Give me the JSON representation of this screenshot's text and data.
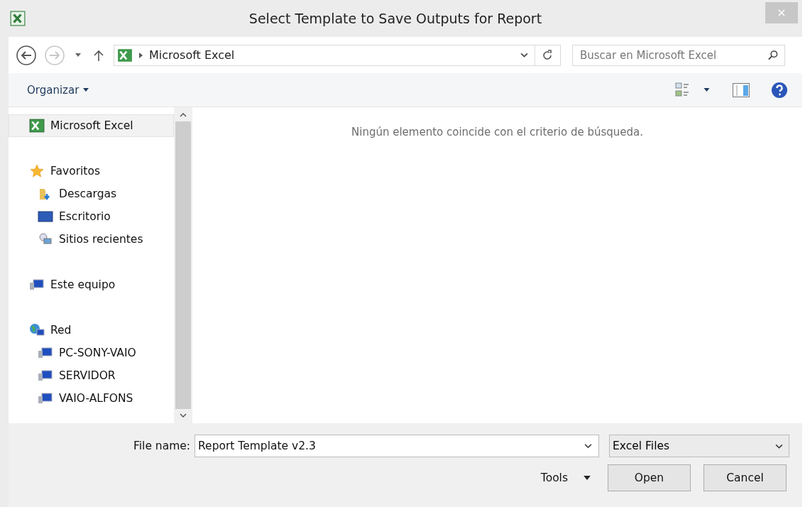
{
  "window": {
    "title": "Select Template to Save Outputs for Report"
  },
  "navigation": {
    "back": {
      "disabled": false
    },
    "forward": {
      "disabled": true
    },
    "path": [
      "Microsoft Excel"
    ],
    "search": {
      "placeholder": "Buscar en Microsoft Excel"
    }
  },
  "toolbar": {
    "organize": "Organizar"
  },
  "sidebar": {
    "items": [
      {
        "label": "Microsoft Excel",
        "kind": "excel",
        "selected": true
      },
      {
        "label": "Favoritos",
        "kind": "star",
        "selected": false,
        "children": [
          {
            "label": "Descargas",
            "kind": "downloads",
            "selected": false
          },
          {
            "label": "Escritorio",
            "kind": "desktop",
            "selected": false
          },
          {
            "label": "Sitios recientes",
            "kind": "recent",
            "selected": false
          }
        ]
      },
      {
        "label": "Este equipo",
        "kind": "computer",
        "selected": false
      },
      {
        "label": "Red",
        "kind": "network",
        "selected": false,
        "children": [
          {
            "label": "PC-SONY-VAIO",
            "kind": "computer",
            "selected": false
          },
          {
            "label": "SERVIDOR",
            "kind": "computer",
            "selected": false
          },
          {
            "label": "VAIO-ALFONS",
            "kind": "computer",
            "selected": false
          }
        ]
      }
    ]
  },
  "content": {
    "message": "Ningún elemento coincide con el criterio de búsqueda."
  },
  "footer": {
    "file_name_label": "File name:",
    "file_name": "Report Template v2.3",
    "file_type": "Excel Files",
    "tools": "Tools",
    "buttons": [
      "Open",
      "Cancel"
    ]
  }
}
